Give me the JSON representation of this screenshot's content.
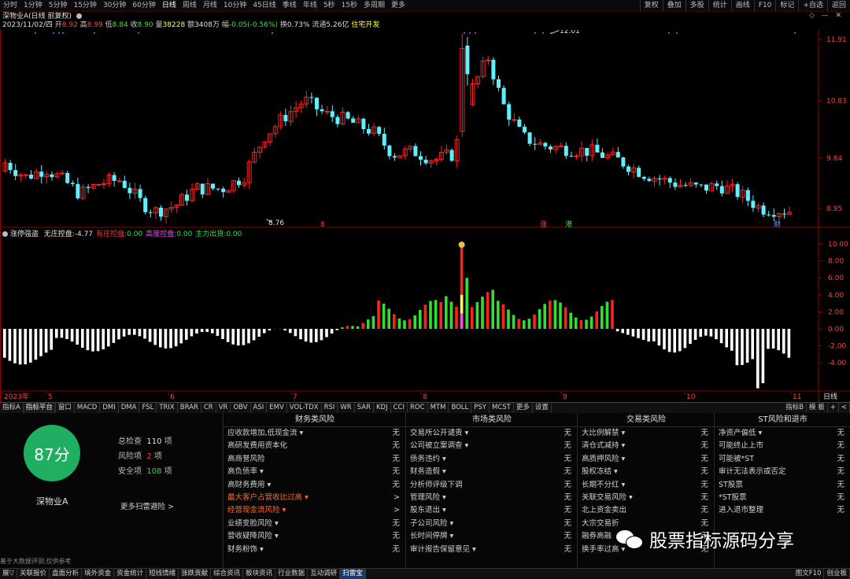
{
  "toolbar": {
    "tabs": [
      "分时",
      "1分钟",
      "5分钟",
      "15分钟",
      "30分钟",
      "60分钟",
      "日线",
      "周线",
      "月线",
      "10分钟",
      "45日线",
      "季线",
      "年线",
      "5秒",
      "15秒",
      "多周期",
      "更多"
    ],
    "active_tab": "日线",
    "right_buttons": [
      "复权",
      "叠加",
      "多股",
      "统计",
      "画线",
      "F10",
      "标记",
      "+自选",
      "返回"
    ]
  },
  "stock": {
    "title": "深物业A(日线 前复权)",
    "date": "2023/11/02/四",
    "open_label": "开",
    "open": "8.92",
    "high_label": "高",
    "high": "8.99",
    "low_label": "低",
    "low": "8.84",
    "close_label": "收",
    "close": "8.90",
    "vol_label": "量",
    "vol": "38228",
    "amount_label": "额",
    "amount": "3408万",
    "change_label": "幅",
    "change": "-0.05(-0.56%)",
    "turnover_label": "换",
    "turnover": "0.73%",
    "float_label": "流通",
    "float": "5.26亿",
    "concept": "住宅开发"
  },
  "price_axis": {
    "labels": [
      "11.91",
      "10.83",
      "9.84",
      "8.95"
    ],
    "max_label": "12.01",
    "min_label": "8.76",
    "markers": [
      "8",
      "涨",
      "港",
      "财"
    ]
  },
  "indicator": {
    "name": "涨停强盗",
    "items": [
      {
        "label": "无庄控盘:",
        "value": "-4.77",
        "color": "#e8e8e8"
      },
      {
        "label": "有庄控盘:",
        "value": "0.00",
        "color": "#ff3030"
      },
      {
        "label": "高度控盘:",
        "value": "0.00",
        "color": "#ff40ff"
      },
      {
        "label": "主力出货:",
        "value": "0.00",
        "color": "#40e040"
      }
    ],
    "axis_labels": [
      "10.00",
      "8.00",
      "6.00",
      "4.00",
      "2.00",
      "0.00",
      "-2.00",
      "-4.00"
    ],
    "top_icon": "money-bag-icon"
  },
  "date_axis": {
    "labels": [
      "2023年",
      "5",
      "6",
      "7",
      "8",
      "9",
      "10",
      "11"
    ],
    "period": "日线"
  },
  "indicator_tabs": [
    "指标A",
    "指标平台",
    "窗口",
    "MACD",
    "DMI",
    "DMA",
    "FSL",
    "TRIX",
    "BRAR",
    "CR",
    "VR",
    "OBV",
    "ASI",
    "EMV",
    "VOL-TDX",
    "RSI",
    "WR",
    "SAR",
    "KDJ",
    "CCI",
    "ROC",
    "MTM",
    "BOLL",
    "PSY",
    "MCST",
    "更多",
    "设置"
  ],
  "indicator_tabs_right": [
    "指标B",
    "模 板",
    "+",
    "<"
  ],
  "score": {
    "value": "87分",
    "stock_name": "深物业A",
    "total_label": "总检查",
    "total": "110",
    "total_unit": "项",
    "risk_label": "风险项",
    "risk": "2",
    "risk_unit": "项",
    "safe_label": "安全项",
    "safe": "108",
    "safe_unit": "项",
    "more": "更多扫雷避险 >",
    "footnote": "基于大数据评测,仅供参考",
    "circle_color": "#1fae62"
  },
  "risk_columns": [
    {
      "title": "财务类风险",
      "items": [
        {
          "name": "应收款增加,低现金流 ▾",
          "status": "无",
          "hl": false
        },
        {
          "name": "高研发费用资本化",
          "status": "无",
          "hl": false
        },
        {
          "name": "高商誉风险",
          "status": "无",
          "hl": false
        },
        {
          "name": "高负债率 ▾",
          "status": "无",
          "hl": false
        },
        {
          "name": "高财务费用 ▾",
          "status": "无",
          "hl": false
        },
        {
          "name": "最大客户占营收比过高 ▾",
          "status": ">",
          "hl": true
        },
        {
          "name": "经营现金流风险 ▾",
          "status": ">",
          "hl": true
        },
        {
          "name": "业绩变脸风险 ▾",
          "status": "无",
          "hl": false
        },
        {
          "name": "营收疑降风险 ▾",
          "status": "无",
          "hl": false
        },
        {
          "name": "财务粉饰 ▾",
          "status": "无",
          "hl": false
        }
      ]
    },
    {
      "title": "市场类风险",
      "items": [
        {
          "name": "交易所公开谴责 ▾",
          "status": "无",
          "hl": false
        },
        {
          "name": "公司被立案调查 ▾",
          "status": "无",
          "hl": false
        },
        {
          "name": "债务违约 ▾",
          "status": "无",
          "hl": false
        },
        {
          "name": "财务造假 ▾",
          "status": "无",
          "hl": false
        },
        {
          "name": "分析师评级下调",
          "status": "无",
          "hl": false
        },
        {
          "name": "管理风险 ▾",
          "status": "无",
          "hl": false
        },
        {
          "name": "股东退出 ▾",
          "status": "无",
          "hl": false
        },
        {
          "name": "子公司风险 ▾",
          "status": "无",
          "hl": false
        },
        {
          "name": "长时间停牌 ▾",
          "status": "无",
          "hl": false
        },
        {
          "name": "审计报告保留意见 ▾",
          "status": "无",
          "hl": false
        }
      ]
    },
    {
      "title": "交易类风险",
      "items": [
        {
          "name": "大比例解禁 ▾",
          "status": "无",
          "hl": false
        },
        {
          "name": "清仓式减持 ▾",
          "status": "无",
          "hl": false
        },
        {
          "name": "高质押风险 ▾",
          "status": "无",
          "hl": false
        },
        {
          "name": "股权冻结 ▾",
          "status": "无",
          "hl": false
        },
        {
          "name": "长期不分红 ▾",
          "status": "无",
          "hl": false
        },
        {
          "name": "关联交易风险 ▾",
          "status": "无",
          "hl": false
        },
        {
          "name": "北上资金卖出",
          "status": "无",
          "hl": false
        },
        {
          "name": "大宗交易折",
          "status": "无",
          "hl": false
        },
        {
          "name": "融券高融",
          "status": "无",
          "hl": false
        },
        {
          "name": "换手率过高 ▾",
          "status": "无",
          "hl": false
        }
      ]
    },
    {
      "title": "ST风险和退市",
      "items": [
        {
          "name": "净资产偏低 ▾",
          "status": "无",
          "hl": false
        },
        {
          "name": "可能终止上市",
          "status": "无",
          "hl": false
        },
        {
          "name": "可能被*ST",
          "status": "无",
          "hl": false
        },
        {
          "name": "审计无法表示或否定",
          "status": "无",
          "hl": false
        },
        {
          "name": "ST股票",
          "status": "无",
          "hl": false
        },
        {
          "name": "*ST股票",
          "status": "无",
          "hl": false
        },
        {
          "name": "进入退市整理",
          "status": "无",
          "hl": false
        }
      ]
    }
  ],
  "watermark": "股票指标源码分享",
  "statusbar": {
    "items": [
      "展▽",
      "关联报价",
      "盘面分析",
      "境外资金",
      "资金统计",
      "短线情绪",
      "涨跌贡献",
      "综合资讯",
      "板块资讯",
      "行业数据",
      "互动调研",
      "扫雷宝"
    ],
    "active": "扫雷宝",
    "right": [
      "图文F10",
      "创业板"
    ]
  },
  "colors": {
    "up": "#ff2020",
    "down": "#5ff0ff",
    "hist_up": "#ff2020",
    "hist_green": "#30e030",
    "hist_white": "#ffffff",
    "axis": "#8b0000"
  }
}
